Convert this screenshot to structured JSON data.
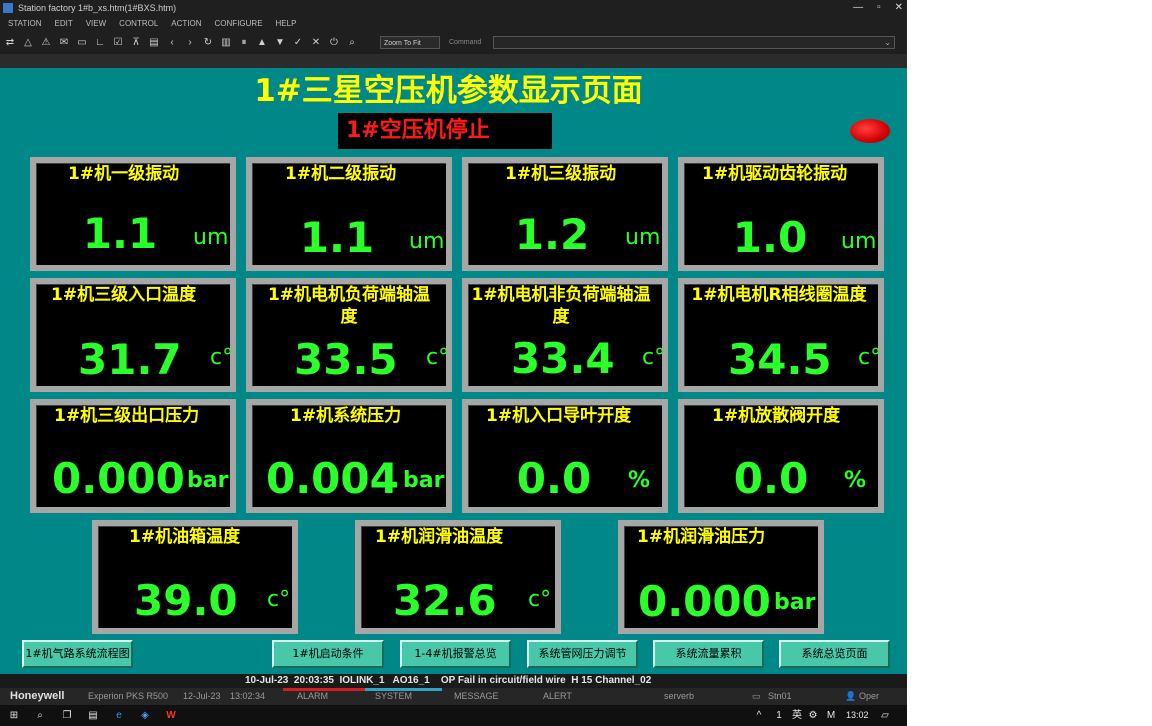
{
  "window": {
    "title": "Station   factory   1#b_xs.htm(1#BXS.htm)",
    "controls": [
      "—",
      "▫",
      "✕"
    ]
  },
  "menu": [
    "STATION",
    "EDIT",
    "VIEW",
    "CONTROL",
    "ACTION",
    "CONFIGURE",
    "HELP"
  ],
  "toolbar": {
    "zoom_value": "Zoom To Fit",
    "command_label": "Command",
    "command_value": ""
  },
  "screen": {
    "title": "1#三星空压机参数显示页面",
    "status_text": "1#空压机停止",
    "status_color": "#ff1a1a",
    "lamp_color": "#e00000"
  },
  "panels": [
    {
      "label": "1#机一级振动",
      "value": "1.1",
      "unit": "um"
    },
    {
      "label": "1#机二级振动",
      "value": "1.1",
      "unit": "um"
    },
    {
      "label": "1#机三级振动",
      "value": "1.2",
      "unit": "um"
    },
    {
      "label": "1#机驱动齿轮振动",
      "value": "1.0",
      "unit": "um"
    },
    {
      "label": "1#机三级入口温度",
      "value": "31.7",
      "unit": "c°"
    },
    {
      "label": "1#机电机负荷端轴温度",
      "value": "33.5",
      "unit": "c°"
    },
    {
      "label": "1#机电机非负荷端轴温度",
      "value": "33.4",
      "unit": "c°"
    },
    {
      "label": "1#机电机R相线圈温度",
      "value": "34.5",
      "unit": "c°"
    },
    {
      "label": "1#机三级出口压力",
      "value": "0.000",
      "unit": "bar"
    },
    {
      "label": "1#机系统压力",
      "value": "0.004",
      "unit": "bar"
    },
    {
      "label": "1#机入口导叶开度",
      "value": "0.0",
      "unit": "%"
    },
    {
      "label": "1#机放散阀开度",
      "value": "0.0",
      "unit": "%"
    },
    {
      "label": "1#机油箱温度",
      "value": "39.0",
      "unit": "c°"
    },
    {
      "label": "1#机润滑油温度",
      "value": "32.6",
      "unit": "c°"
    },
    {
      "label": "1#机润滑油压力",
      "value": "0.000",
      "unit": "bar"
    }
  ],
  "nav_buttons": [
    "1#机气路系统流程图",
    "1#机启动条件",
    "1-4#机报警总览",
    "系统管网压力调节",
    "系统流量累积",
    "系统总览页面"
  ],
  "alarm_line": "10-Jul-23  20:03:35  IOLINK_1   AO16_1    OP Fail in circuit/field wire  H 15 Channel_02",
  "statusbar": {
    "brand": "Honeywell",
    "version": "Experion PKS R500",
    "date": "12-Jul-23",
    "time": "13:02:34",
    "alarm": "ALARM",
    "system": "SYSTEM",
    "message": "MESSAGE",
    "alert": "ALERT",
    "server": "serverb",
    "station": "Stn01",
    "operator": "Oper"
  },
  "taskbar": {
    "lang": "英",
    "clock": "13:02"
  }
}
